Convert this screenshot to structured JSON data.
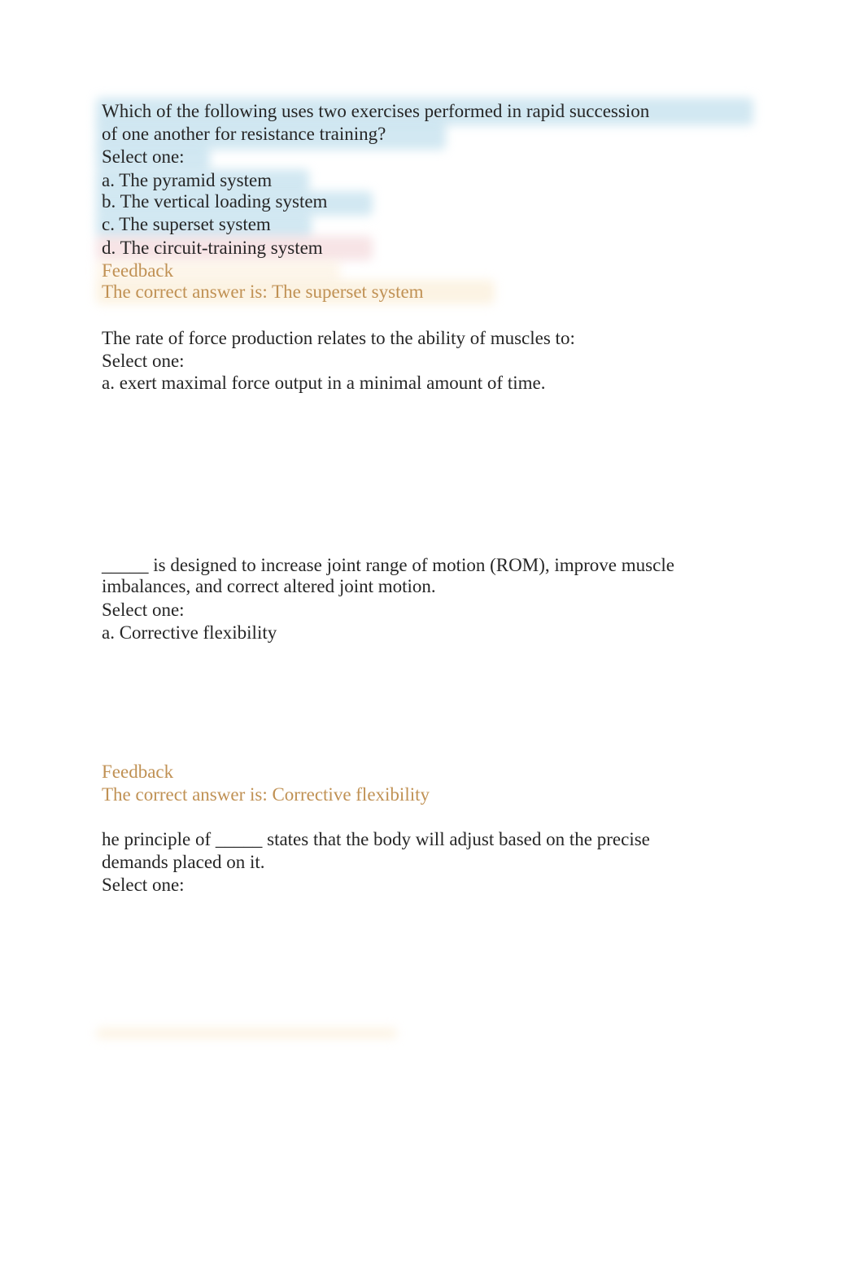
{
  "document": {
    "questions": [
      {
        "prompt_lines": [
          "Which of the following uses two exercises performed in rapid succession",
          "of one another for resistance training?"
        ],
        "select_label": "Select one:",
        "options": [
          "a. The pyramid system",
          "b. The vertical loading system",
          "c. The superset system",
          "d. The circuit-training system"
        ],
        "feedback_label": "Feedback",
        "feedback_answer": "The correct answer is: The superset system"
      },
      {
        "prompt_lines": [
          "The rate of force production relates to the ability of muscles to:"
        ],
        "select_label": "Select one:",
        "options": [
          "a. exert maximal force output in a minimal amount of time."
        ]
      },
      {
        "prompt_lines": [
          "_____ is designed to increase joint range of motion (ROM), improve muscle",
          "imbalances, and correct altered joint motion."
        ],
        "select_label": "Select one:",
        "options": [
          "a. Corrective flexibility"
        ],
        "feedback_label": "Feedback",
        "feedback_answer": "The correct answer is: Corrective flexibility"
      },
      {
        "prompt_lines": [
          "he principle of _____ states that the body will adjust based on the precise",
          "demands placed on it."
        ],
        "select_label": "Select one:"
      }
    ]
  },
  "colors": {
    "text": "#262626",
    "feedback": "#c09154",
    "highlight_blue": "#add6e8",
    "highlight_pink": "#f0cdd2",
    "highlight_yellow": "#fae8c8"
  }
}
